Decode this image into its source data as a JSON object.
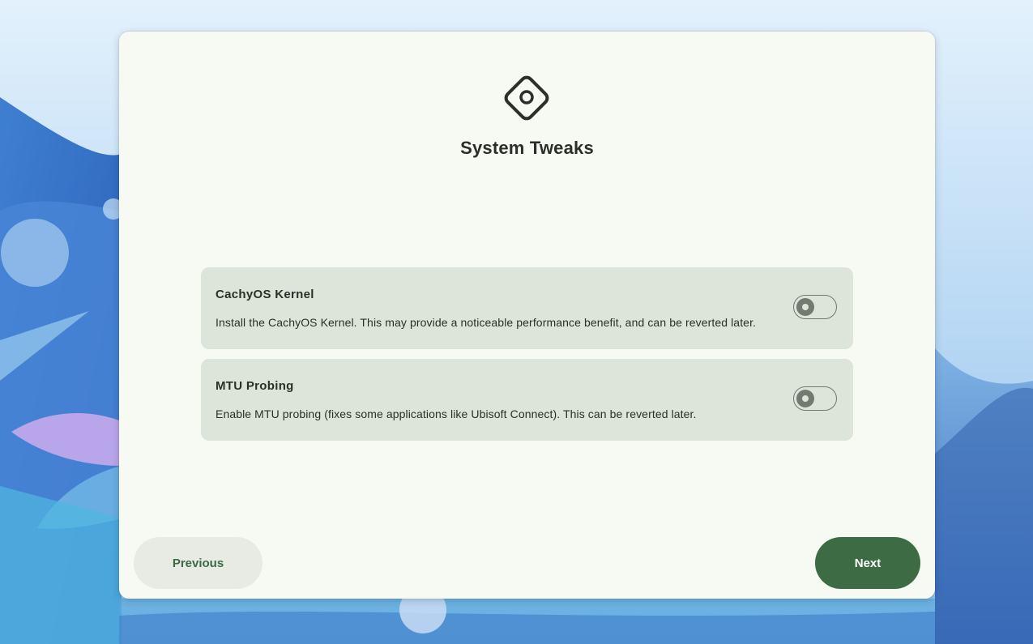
{
  "page": {
    "title": "System Tweaks",
    "header_icon": "diamond-tweak-icon"
  },
  "options": [
    {
      "title": "CachyOS Kernel",
      "description": "Install the CachyOS Kernel. This may provide a noticeable performance benefit, and can be reverted later.",
      "enabled": false
    },
    {
      "title": "MTU Probing",
      "description": "Enable MTU probing (fixes some applications like Ubisoft Connect). This can be reverted later.",
      "enabled": false
    }
  ],
  "navigation": {
    "previous_label": "Previous",
    "next_label": "Next"
  },
  "colors": {
    "window_bg": "#f7f9f3",
    "row_bg": "#dde4d9",
    "accent": "#3d6b43",
    "text": "#2b2f2a"
  }
}
